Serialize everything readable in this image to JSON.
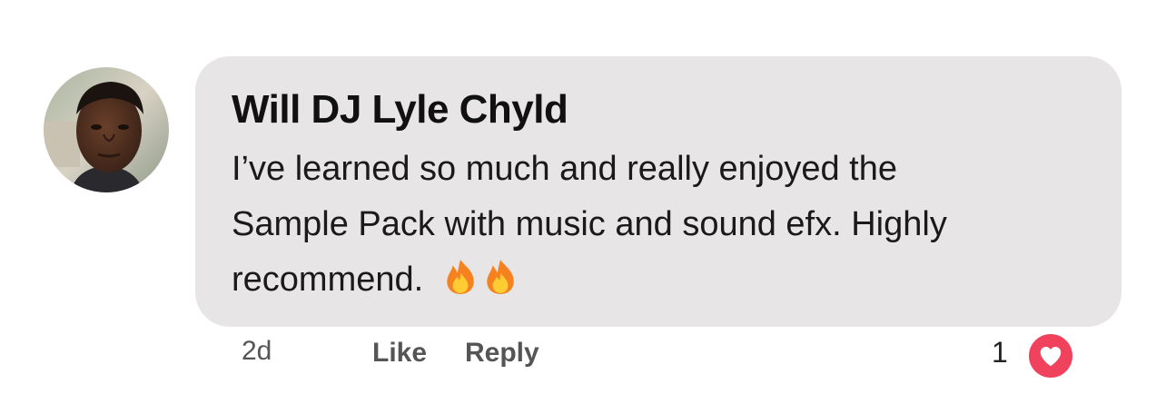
{
  "comment": {
    "author": "Will DJ Lyle Chyld",
    "body_lines": [
      "I’ve learned so much and really enjoyed the",
      "Sample Pack with music and sound efx. Highly",
      "recommend."
    ],
    "emoji": [
      "fire-emoji",
      "fire-emoji"
    ],
    "avatar": "profile-photo",
    "timestamp": "2d",
    "like_label": "Like",
    "reply_label": "Reply",
    "reaction_count": "1",
    "reaction_type": "love-heart-icon"
  },
  "colors": {
    "bubble": "#e7e5e6",
    "heart": "#f0425c",
    "meta_text": "#555555"
  }
}
